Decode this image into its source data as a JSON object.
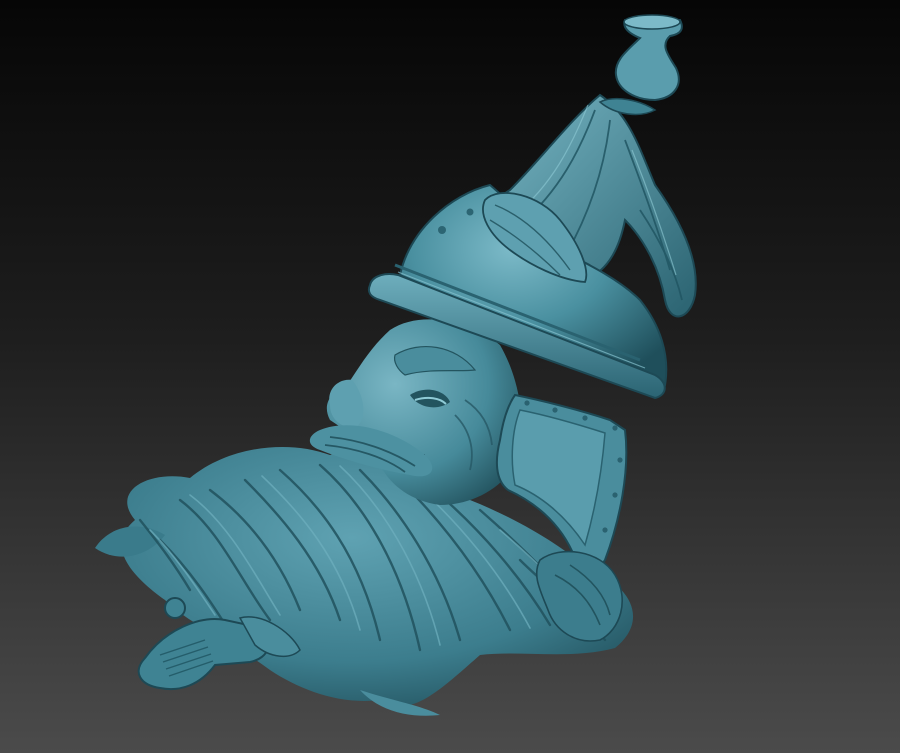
{
  "scene": {
    "background_top": "#060606",
    "background_bottom": "#4b4b4b",
    "model_base": "#3f8393",
    "model_highlight": "#6fb0bf",
    "model_shadow": "#1d4955",
    "model_rim": "#8fcbd6"
  },
  "model": {
    "parts": [
      "helmet-dome",
      "helmet-rim-band",
      "helmet-cheek-guard",
      "plume",
      "finial",
      "face",
      "eyebrow",
      "moustache",
      "beard",
      "sword-hilt"
    ]
  }
}
